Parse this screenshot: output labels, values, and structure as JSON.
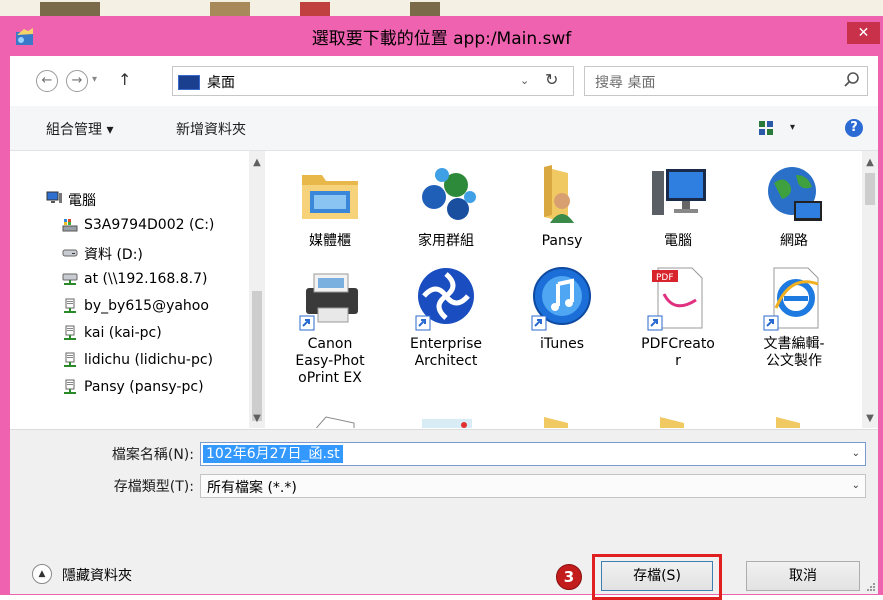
{
  "window": {
    "title": "選取要下載的位置 app:/Main.swf",
    "close_label": "✕"
  },
  "address_bar": {
    "nav_back_label": "←",
    "nav_forward_label": "→",
    "nav_dropdown_label": "▾",
    "nav_up_label": "↑",
    "location": "桌面",
    "dropdown_label": "⌄",
    "refresh_label": "↻",
    "search_placeholder": "搜尋 桌面"
  },
  "toolbar": {
    "organize_label": "組合管理 ▾",
    "new_folder_label": "新增資料夾",
    "view_dropdown_label": "▾",
    "help_label": "?"
  },
  "nav_tree": {
    "items": [
      {
        "label": "電腦",
        "icon": "computer-icon"
      },
      {
        "label": "S3A9794D002 (C:)",
        "icon": "drive-icon"
      },
      {
        "label": "資料 (D:)",
        "icon": "drive-icon"
      },
      {
        "label": "at (\\\\192.168.8.7)",
        "icon": "network-drive-icon"
      },
      {
        "label": "by_by615@yahoo",
        "icon": "network-share-icon"
      },
      {
        "label": "kai (kai-pc)",
        "icon": "network-share-icon"
      },
      {
        "label": "lidichu (lidichu-pc)",
        "icon": "network-share-icon"
      },
      {
        "label": "Pansy (pansy-pc)",
        "icon": "network-share-icon"
      }
    ]
  },
  "files": {
    "row1": [
      {
        "label": "媒體櫃",
        "icon": "library-folder-icon"
      },
      {
        "label": "家用群組",
        "icon": "homegroup-icon"
      },
      {
        "label": "Pansy",
        "icon": "user-folder-icon"
      },
      {
        "label": "電腦",
        "icon": "computer-icon"
      },
      {
        "label": "網路",
        "icon": "network-icon"
      }
    ],
    "row2": [
      {
        "label": "Canon Easy-PhotoPrint EX",
        "lines": [
          "Canon",
          "Easy-Phot",
          "oPrint EX"
        ],
        "icon": "printer-shortcut-icon"
      },
      {
        "label": "Enterprise Architect",
        "lines": [
          "Enterprise",
          "Architect"
        ],
        "icon": "enterprise-architect-icon"
      },
      {
        "label": "iTunes",
        "lines": [
          "iTunes"
        ],
        "icon": "itunes-icon"
      },
      {
        "label": "PDFCreator",
        "lines": [
          "PDFCreato",
          "r"
        ],
        "icon": "pdf-icon"
      },
      {
        "label": "文書編輯-公文製作",
        "lines": [
          "文書編輯-",
          "公文製作"
        ],
        "icon": "ie-icon"
      }
    ]
  },
  "form": {
    "filename_label": "檔案名稱(N):",
    "filename_value": "102年6月27日_函.st",
    "filetype_label": "存檔類型(T):",
    "filetype_value": "所有檔案 (*.*)",
    "dropdown_label": "⌄"
  },
  "footer": {
    "hide_folders_label": "隱藏資料夾",
    "hide_toggle_label": "▲",
    "step_badge": "3",
    "save_label": "存檔(S)",
    "cancel_label": "取消"
  },
  "colors": {
    "title_bar": "#ee62b0",
    "close_button": "#c9304a",
    "selection": "#3399ff",
    "highlight_outline": "#e02020",
    "step_badge": "#c31c1c"
  }
}
